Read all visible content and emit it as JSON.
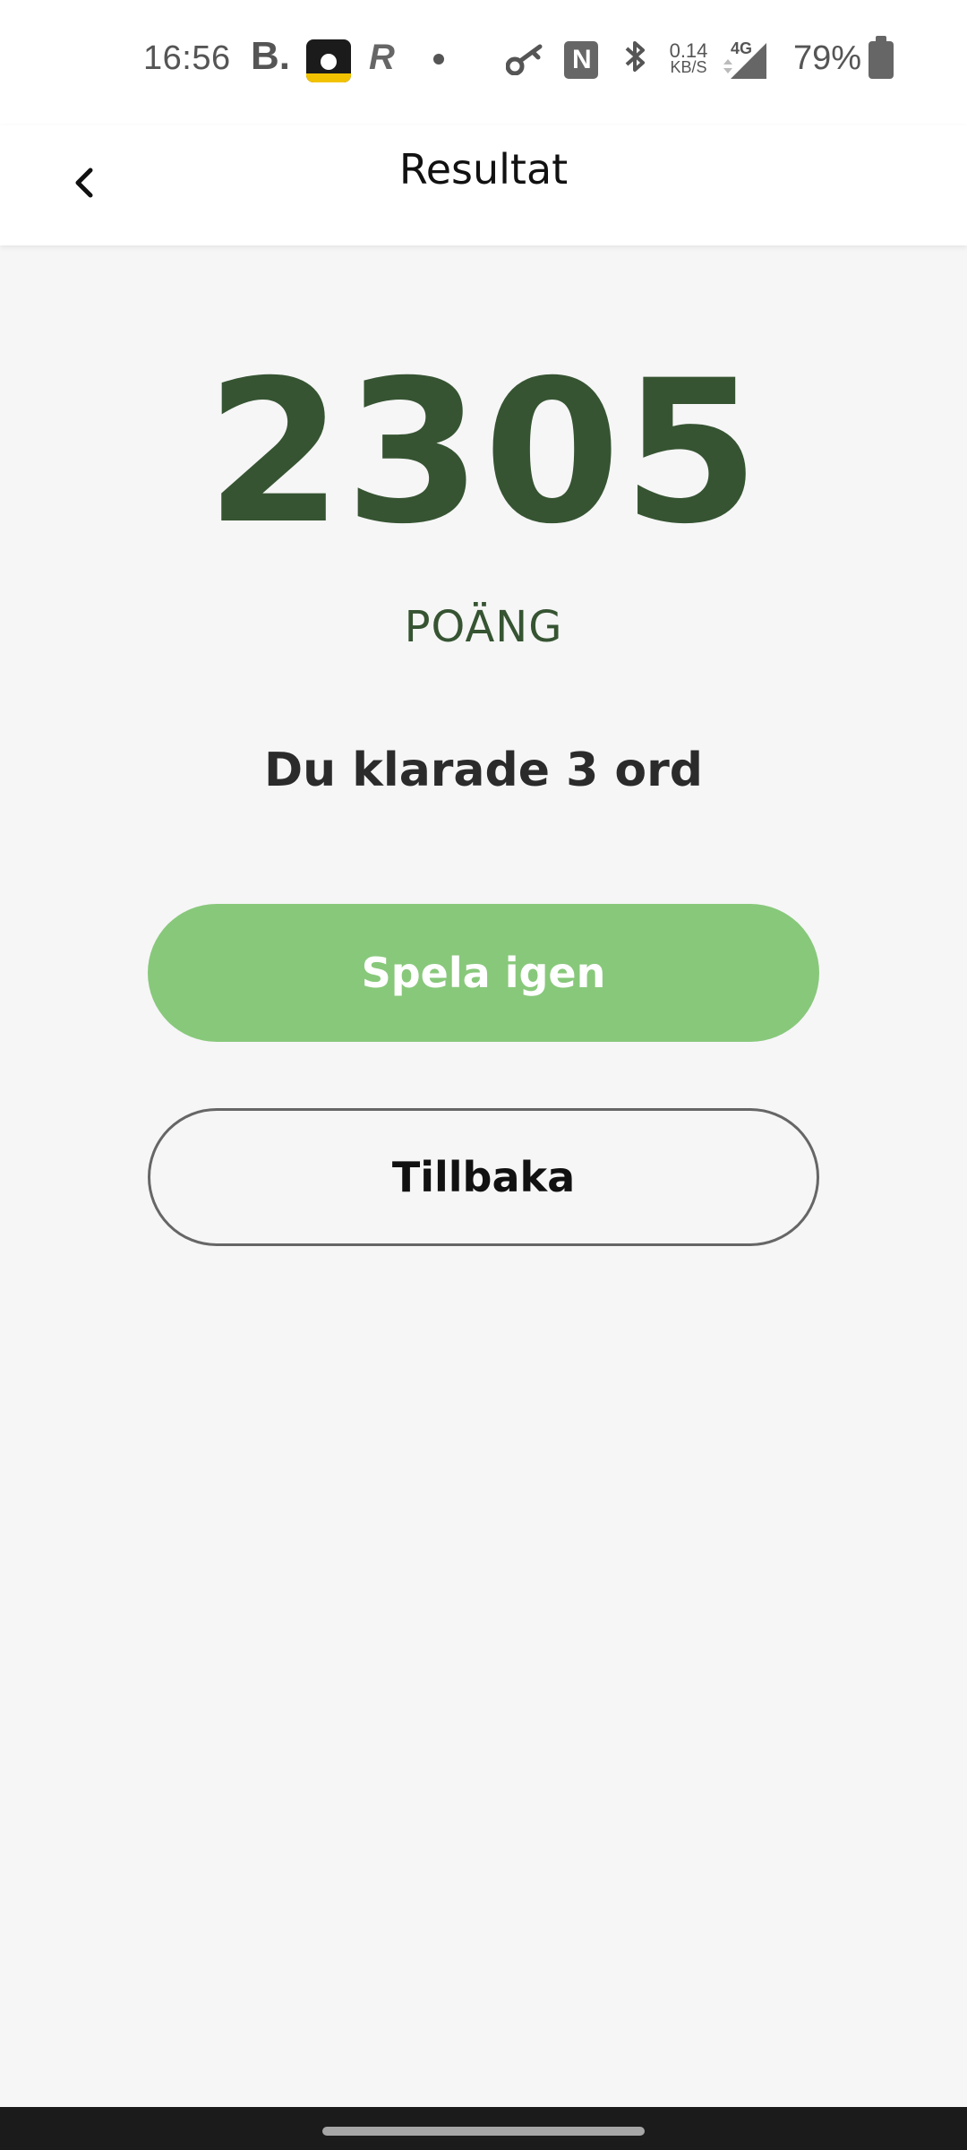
{
  "status_bar": {
    "time": "16:56",
    "booking_letter": "B.",
    "revolut_letter": "R",
    "network_speed_value": "0.14",
    "network_speed_unit": "KB/S",
    "network_type": "4G",
    "battery_percent": "79%",
    "icons": [
      "booking-icon",
      "app-icon",
      "revolut-icon",
      "dot-icon",
      "key-icon",
      "nfc-icon",
      "bluetooth-icon",
      "signal-icon",
      "battery-icon"
    ]
  },
  "header": {
    "title": "Resultat",
    "back_icon": "chevron-left-icon"
  },
  "result": {
    "score": "2305",
    "score_label": "POÄNG",
    "summary": "Du klarade 3 ord"
  },
  "actions": {
    "play_again_label": "Spela igen",
    "back_label": "Tillbaka"
  },
  "colors": {
    "accent_dark_green": "#365432",
    "primary_button_green": "#88c87b",
    "background": "#f6f6f6"
  }
}
